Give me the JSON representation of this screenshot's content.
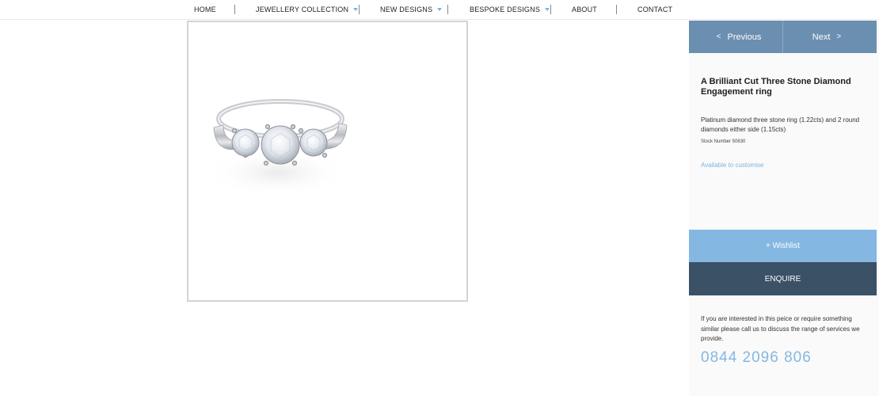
{
  "nav": {
    "items": [
      {
        "label": "HOME",
        "dropdown": false
      },
      {
        "label": "JEWELLERY COLLECTION",
        "dropdown": true
      },
      {
        "label": "NEW DESIGNS",
        "dropdown": true
      },
      {
        "label": "BESPOKE DESIGNS",
        "dropdown": true
      },
      {
        "label": "ABOUT",
        "dropdown": false
      },
      {
        "label": "CONTACT",
        "dropdown": false
      }
    ]
  },
  "pager": {
    "previous_chevron": "<",
    "previous_label": "Previous",
    "next_label": "Next",
    "next_chevron": ">"
  },
  "product": {
    "title": "A Brilliant Cut Three Stone Diamond Engagement ring",
    "description": "Platinum diamond three stone ring (1.22cts) and 2 round diamonds either side (1.15cts)",
    "stock": "Stock Number 50630",
    "customise_link": "Available to customise"
  },
  "actions": {
    "wishlist_label": "+ Wishlist",
    "enquire_label": "ENQUIRE"
  },
  "contact": {
    "note": "If you are interested in this peice or require something similar please call us to discuss the range of services we provide.",
    "phone": "0844 2096 806"
  },
  "colors": {
    "pager_bg": "#6b8fb0",
    "wishlist_bg": "#84b7e2",
    "enquire_bg": "#3a5166",
    "accent": "#7fb3dc",
    "panel_bg": "#fafafa"
  }
}
